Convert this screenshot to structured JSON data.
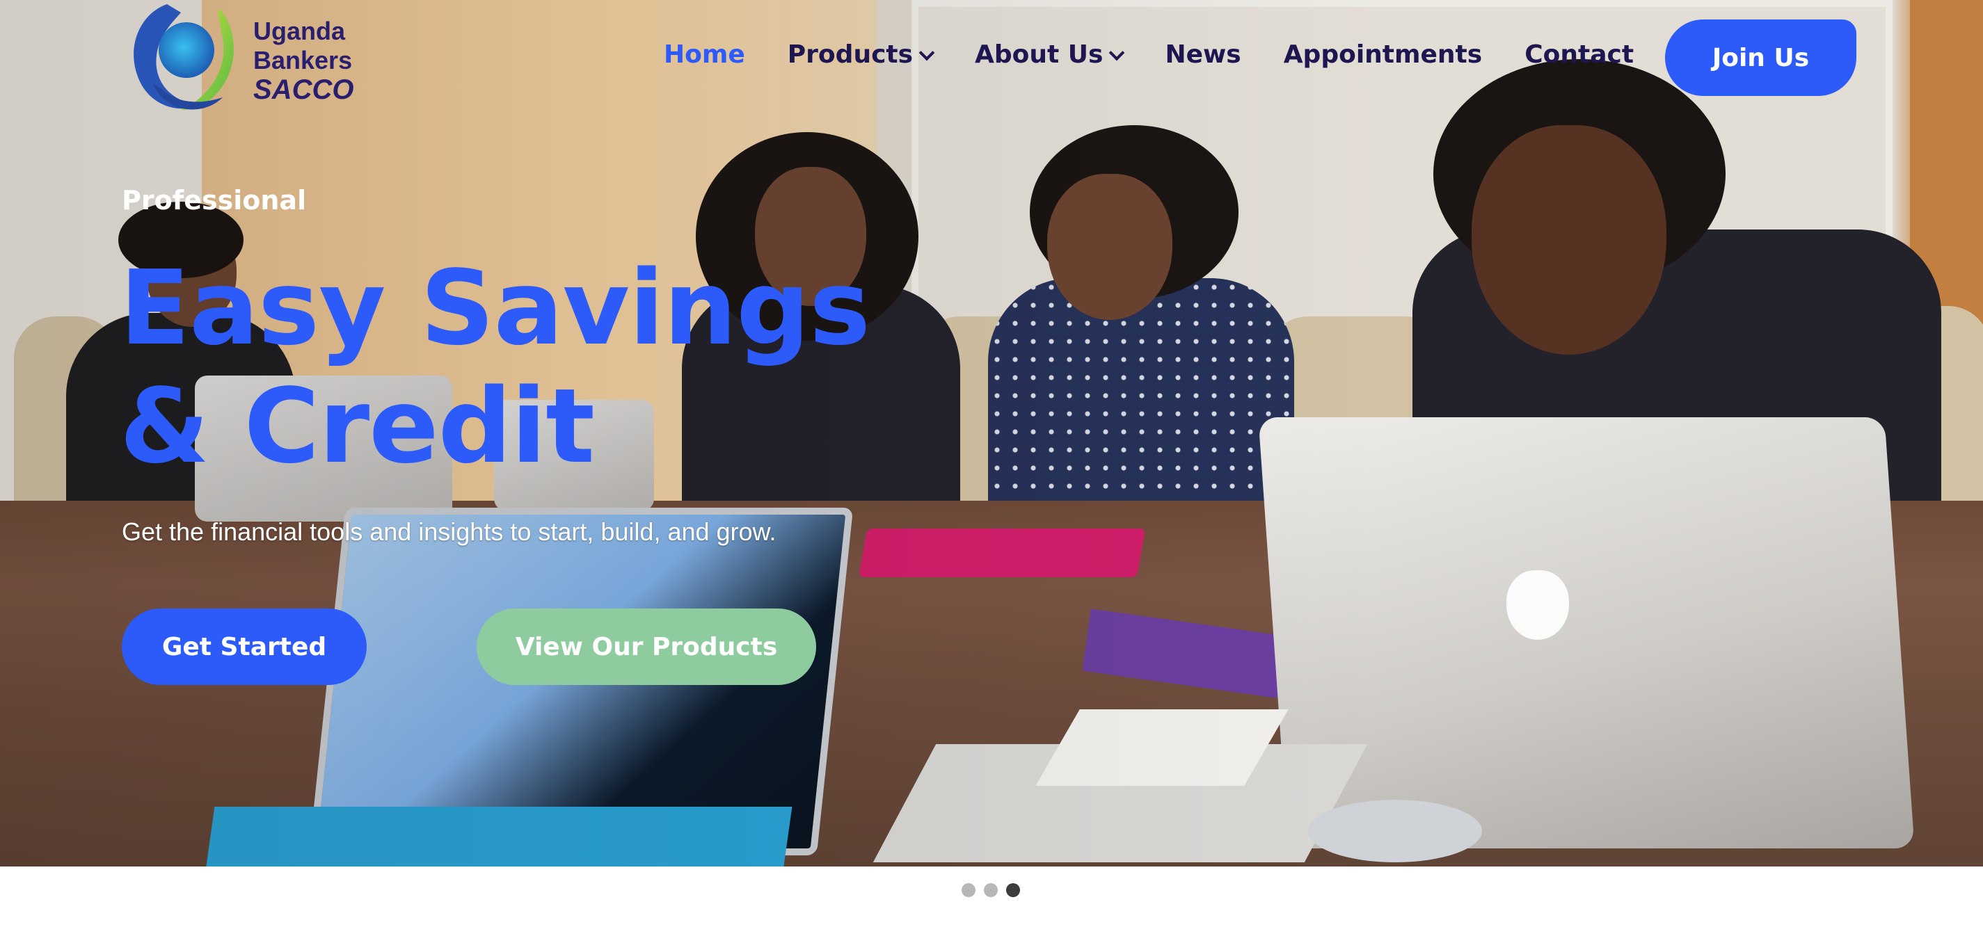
{
  "brand": {
    "line1": "Uganda",
    "line2": "Bankers",
    "line3": "SACCO",
    "logo_icon": "sacco-logo-icon"
  },
  "nav": {
    "items": [
      {
        "label": "Home",
        "active": true,
        "has_dropdown": false
      },
      {
        "label": "Products",
        "active": false,
        "has_dropdown": true
      },
      {
        "label": "About Us",
        "active": false,
        "has_dropdown": true
      },
      {
        "label": "News",
        "active": false,
        "has_dropdown": false
      },
      {
        "label": "Appointments",
        "active": false,
        "has_dropdown": false
      },
      {
        "label": "Contact",
        "active": false,
        "has_dropdown": false
      }
    ],
    "cta_label": "Join Us"
  },
  "hero": {
    "eyebrow": "Professional",
    "headline_line1": "Easy Savings",
    "headline_line2": "& Credit",
    "subline": "Get the financial tools and insights to start, build, and grow.",
    "primary_button": "Get Started",
    "secondary_button": "View Our Products",
    "background_image": "meeting-room-photo"
  },
  "carousel": {
    "slide_count": 3,
    "active_index": 2
  },
  "colors": {
    "accent_blue": "#2c5bfa",
    "nav_text": "#1d1650",
    "secondary_green": "#8ecb9e",
    "dot_inactive": "#b7b7b7",
    "dot_active": "#3c3c3c"
  }
}
